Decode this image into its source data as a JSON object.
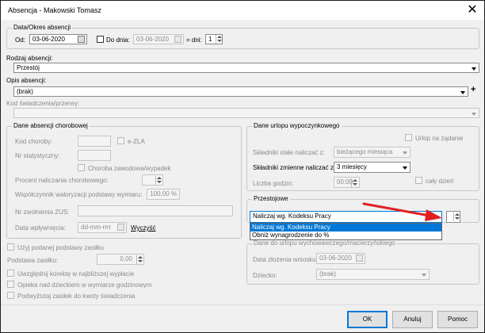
{
  "window": {
    "title": "Absencja - Makowski Tomasz",
    "close": "✕"
  },
  "period": {
    "group": "Data/Okres absencji",
    "from_label": "Od:",
    "from_value": "03-06-2020",
    "to_label": "Do dnia:",
    "to_value": "03-06-2020",
    "days_label": "= dni:",
    "days_value": "1"
  },
  "type": {
    "label": "Rodzaj absencji:",
    "value": "Przestój"
  },
  "description": {
    "label": "Opis absencji:",
    "value": "(brak)",
    "add": "+"
  },
  "benefit_code": {
    "label": "Kod świadczenia/przerwy:",
    "value": ""
  },
  "sick": {
    "group": "Dane absencji chorobowej",
    "disease_code_label": "Kod choroby:",
    "ezla_label": "e-ZLA",
    "stat_no_label": "Nr statystyczny:",
    "occupational_label": "Choroba zawodowa/wypadek",
    "percent_label": "Procent naliczania chorobowego:",
    "indexation_label": "Współczynnik waloryzacji podstawy wymiaru:",
    "indexation_value": "100,00 %",
    "zus_no_label": "Nr zwolnienia ZUS:",
    "payment_date_label": "Data wpływnięcia:",
    "payment_date_value": "dd-mm-rrrr",
    "clear_link": "Wyczyść"
  },
  "vacation": {
    "group": "Dane urlopu wypoczynkowego",
    "on_demand": "Urlop na żądanie",
    "fixed_label": "Składniki stałe naliczać z:",
    "fixed_value": "bieżącego miesiąca",
    "variable_label": "Składniki zmienne naliczać z:",
    "variable_value": "3 miesięcy",
    "hours_label": "Liczba godzin:",
    "hours_value": "00:00",
    "full_day": "cały dzień"
  },
  "downtime": {
    "group": "Przestojowe",
    "value": "Naliczaj wg. Kodeksu Pracy",
    "options": [
      "Naliczaj wg. Kodeksu Pracy",
      "Obniż wynagrodzenie do %"
    ]
  },
  "childcare": {
    "group": "Dane do urlopu wychowawczego/macierzyńskiego",
    "request_date_label": "Data złożenia wniosku:",
    "request_date_value": "03-06-2020",
    "child_label": "Dziecko:",
    "child_value": "(brak)"
  },
  "options": {
    "use_base": "Użyj podanej podstawy zasiłku",
    "base_label": "Podstawa zasiłku:",
    "base_value": "0,00",
    "correction": "Uwzględnij korektę w najbliższej wypłacie",
    "care": "Opieka nad dzieckiem w wymiarze godzinowym",
    "raise": "Podwyższaj zasiłek do kwoty świadczenia"
  },
  "buttons": {
    "ok": "OK",
    "cancel": "Anuluj",
    "help": "Pomoc"
  },
  "colors": {
    "accent": "#0078d7",
    "arrow": "#e02020"
  }
}
